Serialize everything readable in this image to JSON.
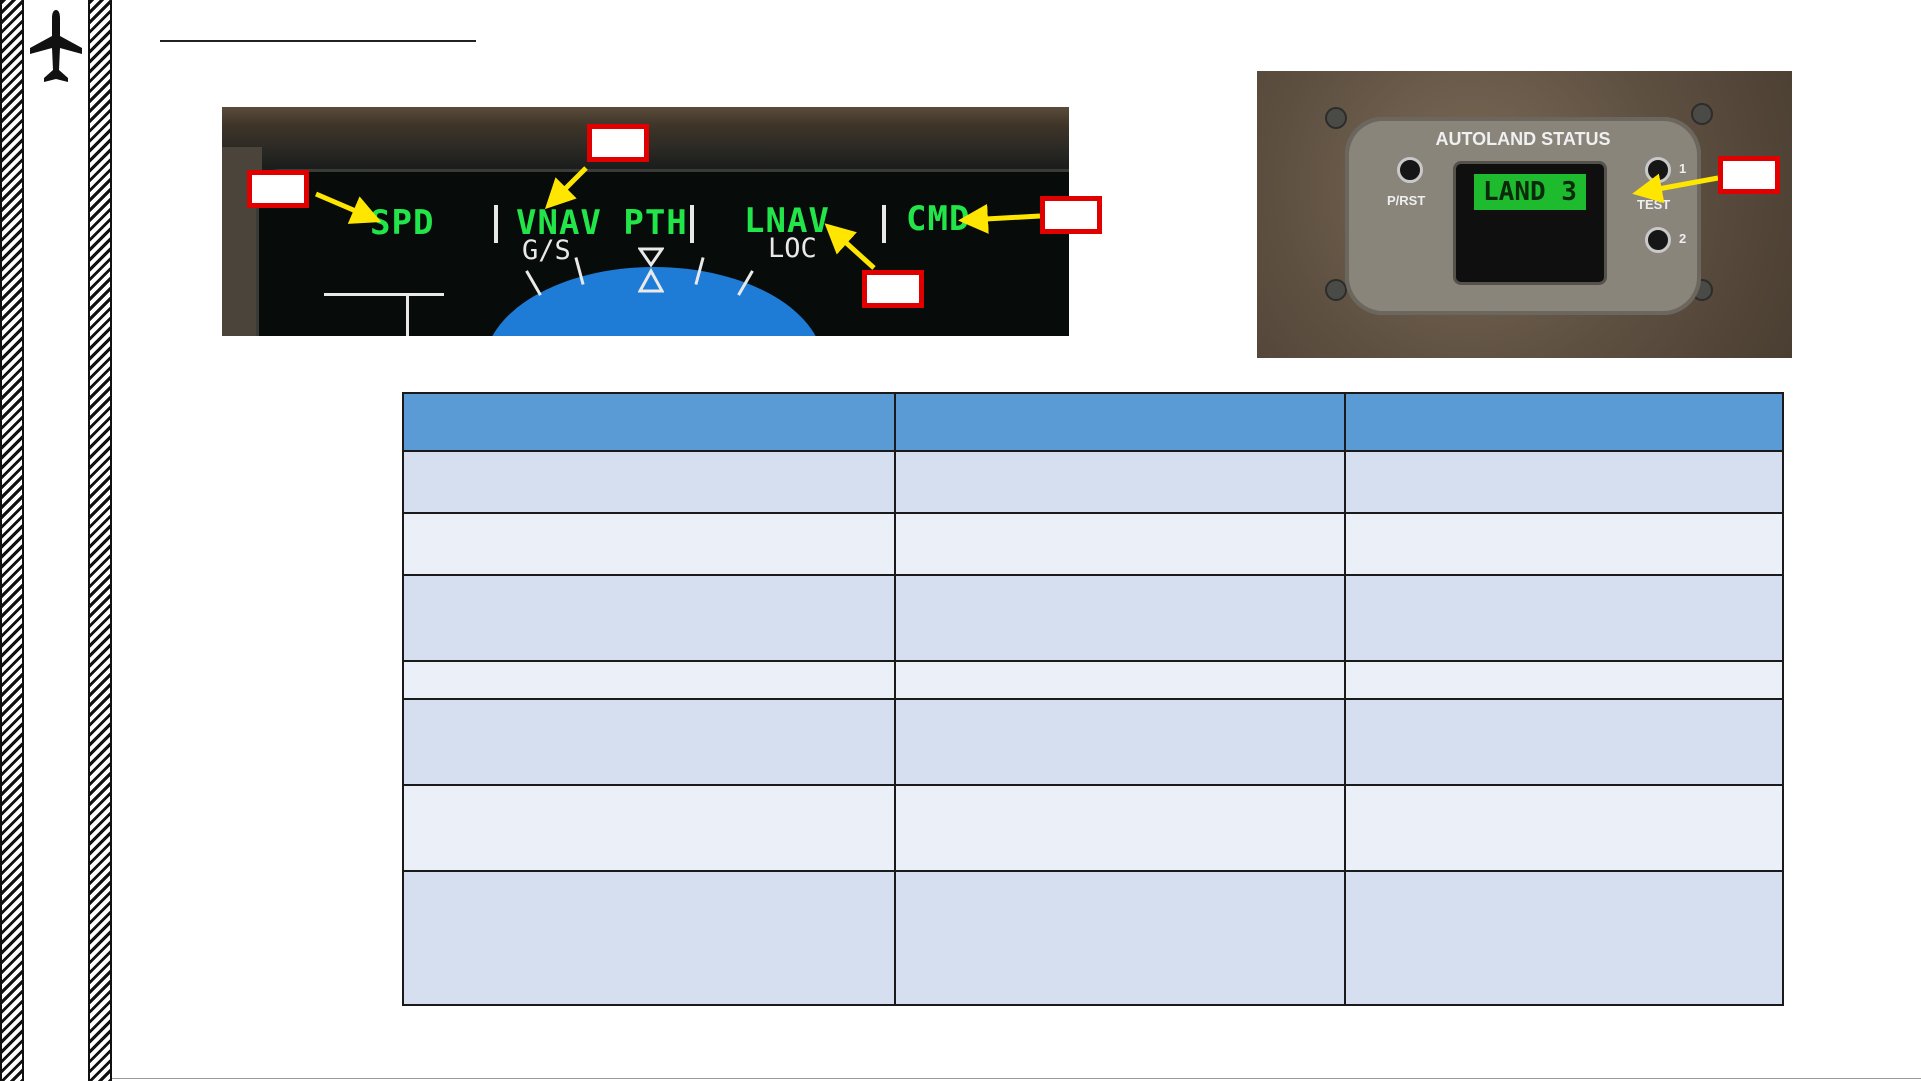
{
  "page": {
    "title": "",
    "footer": ""
  },
  "icons": {
    "plane": "airplane-icon"
  },
  "pfd_figure": {
    "fma": {
      "speed_mode": "SPD",
      "pitch_mode": "VNAV PTH",
      "pitch_armed": "G/S",
      "roll_mode": "LNAV",
      "roll_armed": "LOC",
      "afds_status": "CMD"
    },
    "callouts": [
      "",
      "",
      "",
      "",
      ""
    ]
  },
  "autoland_figure": {
    "panel_title": "AUTOLAND STATUS",
    "display": "LAND 3",
    "labels": {
      "reset": "P/RST",
      "test": "TEST",
      "one": "1",
      "two": "2"
    },
    "callouts": [
      ""
    ]
  },
  "table": {
    "headers": [
      "",
      "",
      ""
    ],
    "rows": [
      [
        "",
        "",
        ""
      ],
      [
        "",
        "",
        ""
      ],
      [
        "",
        "",
        ""
      ],
      [
        "",
        "",
        ""
      ],
      [
        "",
        "",
        ""
      ],
      [
        "",
        "",
        ""
      ],
      [
        "",
        "",
        ""
      ]
    ]
  },
  "colors": {
    "table_header": "#5b9bd5",
    "table_row_odd": "#d5dfef",
    "table_row_even": "#ebeff8",
    "callout_border": "#e00000",
    "arrow": "#ffe600",
    "fma_green": "#22e54a"
  }
}
